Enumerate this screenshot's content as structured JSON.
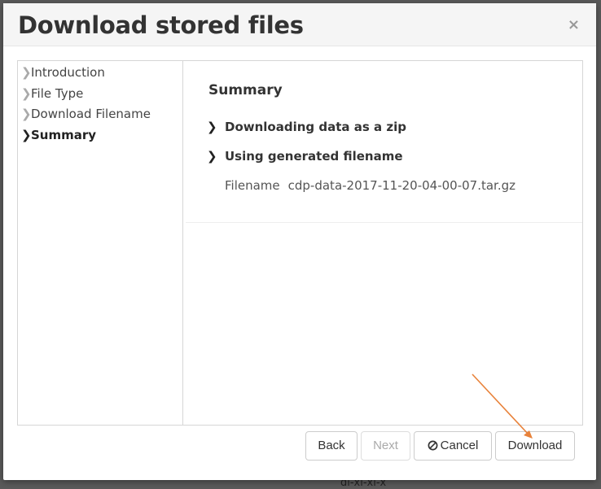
{
  "backdrop": {
    "text": "dl-xl-xl-x"
  },
  "dialog": {
    "title": "Download stored files",
    "close_glyph": "×"
  },
  "steps": [
    {
      "label": "Introduction",
      "active": false
    },
    {
      "label": "File Type",
      "active": false
    },
    {
      "label": "Download Filename",
      "active": false
    },
    {
      "label": "Summary",
      "active": true
    }
  ],
  "summary": {
    "heading": "Summary",
    "items": [
      "Downloading data as a zip",
      "Using generated filename"
    ],
    "filename_label": "Filename",
    "filename_value": "cdp-data-2017-11-20-04-00-07.tar.gz"
  },
  "buttons": {
    "back": "Back",
    "next": "Next",
    "cancel": "Cancel",
    "download": "Download"
  },
  "annotation": {
    "arrow_color": "#e8823a"
  },
  "icons": {
    "step_chevron": "chevron-right-icon",
    "cancel_icon": "ban-icon"
  }
}
